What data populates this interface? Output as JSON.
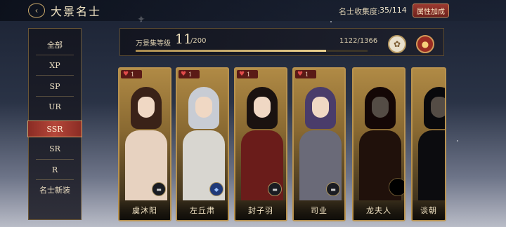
{
  "header": {
    "title": "大景名士",
    "collect_label": "名士收集度:",
    "collect_value": "35/114",
    "attr_button": "属性加成"
  },
  "sidebar": {
    "items": [
      "全部",
      "XP",
      "SP",
      "UR",
      "SSR",
      "SR",
      "R",
      "名士新装"
    ],
    "active_index": 4
  },
  "level": {
    "label": "万景集等级",
    "value": "11",
    "max": "/200",
    "exp": "1122/1366",
    "progress": 0.82
  },
  "cards": [
    {
      "name": "虞沐阳",
      "hearts": "1",
      "skill": "minus",
      "locked": false,
      "hair": "#3a2218",
      "robe": "#e7d2c0"
    },
    {
      "name": "左丘肃",
      "hearts": "1",
      "skill": "blue",
      "locked": false,
      "hair": "#c8ccd4",
      "robe": "#d8d6d0"
    },
    {
      "name": "封子羽",
      "hearts": "1",
      "skill": "minus",
      "locked": false,
      "hair": "#1a1210",
      "robe": "#6a1c1a"
    },
    {
      "name": "司业",
      "hearts": "1",
      "skill": "minus",
      "locked": false,
      "hair": "#4a3c6a",
      "robe": "#6a6a78"
    },
    {
      "name": "龙夫人",
      "hearts": "",
      "skill": "",
      "locked": true,
      "hair": "#3a1410",
      "robe": "#5a3020"
    },
    {
      "name": "谈朝",
      "hearts": "",
      "skill": "",
      "locked": true,
      "hair": "#1a1a22",
      "robe": "#22222a"
    }
  ]
}
